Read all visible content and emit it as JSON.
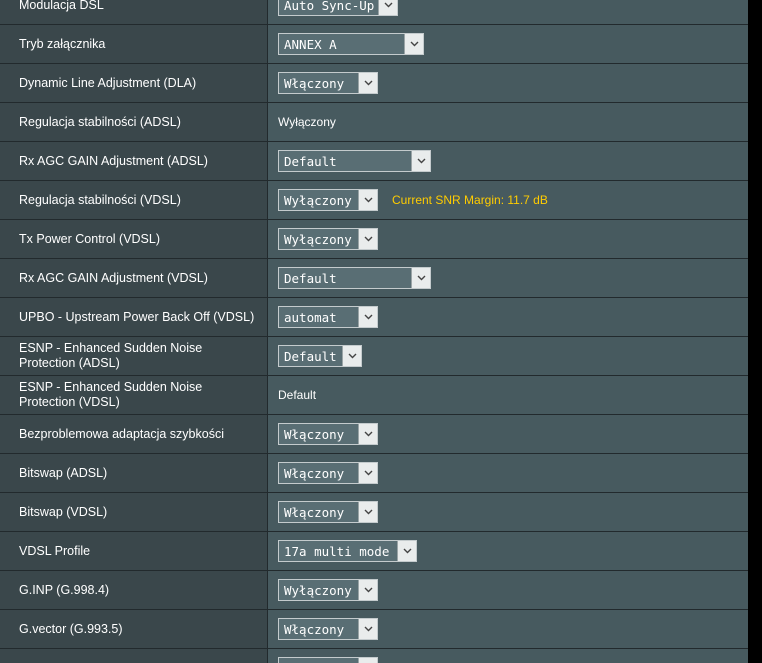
{
  "rows": [
    {
      "label": "Modulacja DSL",
      "value": "Auto Sync-Up",
      "w": 120
    },
    {
      "label": "Tryb załącznika",
      "value": "ANNEX A",
      "w": 146
    },
    {
      "label": "Dynamic Line Adjustment (DLA)",
      "value": "Włączony",
      "w": 100
    },
    {
      "label": "Regulacja stabilności (ADSL)",
      "plain": "Wyłączony"
    },
    {
      "label": "Rx AGC GAIN Adjustment (ADSL)",
      "value": "Default",
      "w": 153
    },
    {
      "label": "Regulacja stabilności (VDSL)",
      "value": "Wyłączony",
      "w": 100,
      "note": "Current SNR Margin: 11.7 dB"
    },
    {
      "label": "Tx Power Control (VDSL)",
      "value": "Wyłączony",
      "w": 100
    },
    {
      "label": "Rx AGC GAIN Adjustment (VDSL)",
      "value": "Default",
      "w": 153
    },
    {
      "label": "UPBO - Upstream Power Back Off (VDSL)",
      "value": "automat",
      "w": 100
    },
    {
      "label": "ESNP - Enhanced Sudden Noise Protection (ADSL)",
      "value": "Default",
      "w": 84
    },
    {
      "label": "ESNP - Enhanced Sudden Noise Protection (VDSL)",
      "plain": "Default"
    },
    {
      "label": "Bezproblemowa adaptacja szybkości",
      "value": "Włączony",
      "w": 100
    },
    {
      "label": "Bitswap (ADSL)",
      "value": "Włączony",
      "w": 100
    },
    {
      "label": "Bitswap (VDSL)",
      "value": "Włączony",
      "w": 100
    },
    {
      "label": "VDSL Profile",
      "value": "17a multi mode",
      "w": 139
    },
    {
      "label": "G.INP (G.998.4)",
      "value": "Wyłączony",
      "w": 100
    },
    {
      "label": "G.vector (G.993.5)",
      "value": "Włączony",
      "w": 100
    },
    {
      "label": "",
      "value": "",
      "w": 100
    }
  ],
  "icons": {
    "dropdown": "chevron-down-icon"
  }
}
